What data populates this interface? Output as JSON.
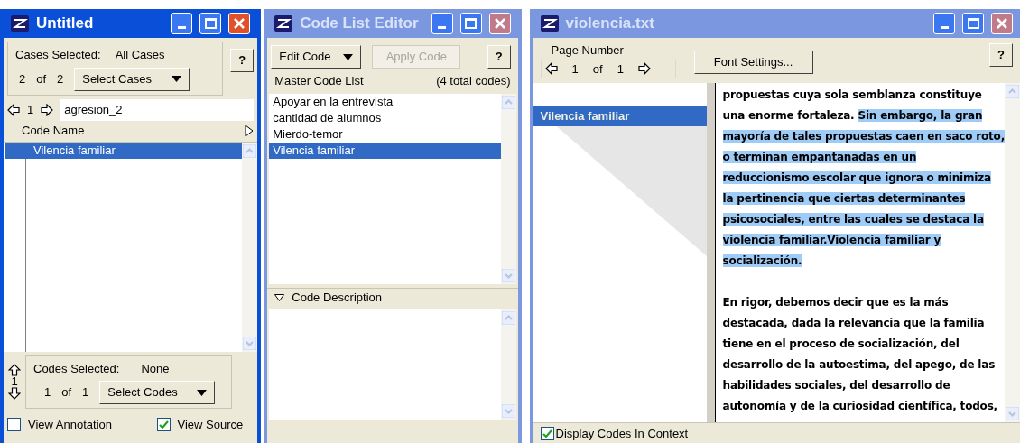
{
  "case_window": {
    "title": "Untitled",
    "active": true,
    "help_button": "?",
    "cases_selected_label": "Cases Selected:",
    "cases_selected_value": "All Cases",
    "case_index": "2",
    "case_of": "of",
    "case_total": "2",
    "select_cases_button": "Select Cases",
    "nav_index": "1",
    "case_name": "agresion_2",
    "column_header": "Code Name",
    "codes": [
      {
        "name": "Vilencia familiar",
        "selected": true
      }
    ],
    "codes_nav_index": "1",
    "codes_selected_label": "Codes Selected:",
    "codes_selected_value": "None",
    "code_index": "1",
    "code_of": "of",
    "code_total": "1",
    "select_codes_button": "Select Codes",
    "checkboxes": [
      {
        "label": "View Annotation",
        "checked": false
      },
      {
        "label": "View Source",
        "checked": true
      }
    ]
  },
  "code_list_editor": {
    "title": "Code List Editor",
    "active": false,
    "edit_code_button": "Edit Code",
    "apply_code_button": {
      "label": "Apply Code",
      "disabled": true
    },
    "help_button": "?",
    "list_label": "Master Code List",
    "total_codes": "(4 total codes)",
    "codes": [
      {
        "name": "Apoyar en la entrevista",
        "selected": false
      },
      {
        "name": "cantidad de alumnos",
        "selected": false
      },
      {
        "name": "Mierdo-temor",
        "selected": false
      },
      {
        "name": "Vilencia familiar",
        "selected": true
      }
    ],
    "description_header": "Code Description",
    "description_expanded": true
  },
  "document_window": {
    "title": "violencia.txt",
    "active": false,
    "page_number_label": "Page Number",
    "page_index": "1",
    "page_of": "of",
    "page_total": "1",
    "font_settings_button": "Font Settings...",
    "help_button": "?",
    "margin_codes": [
      {
        "name": "Vilencia familiar",
        "selected": true
      }
    ],
    "paragraphs": [
      [
        [
          {
            "text": "propuestas cuya sola semblanza constituye",
            "highlighted": false
          }
        ],
        [
          {
            "text": "una enorme fortaleza. ",
            "highlighted": false
          },
          {
            "text": "Sin embargo, la gran",
            "highlighted": true
          }
        ],
        [
          {
            "text": "mayoría de tales propuestas caen en saco roto,",
            "highlighted": true
          }
        ],
        [
          {
            "text": "o terminan empantanadas en un",
            "highlighted": true
          }
        ],
        [
          {
            "text": "reduccionismo escolar que ignora o minimiza",
            "highlighted": true
          }
        ],
        [
          {
            "text": "la pertinencia que ciertas determinantes",
            "highlighted": true
          }
        ],
        [
          {
            "text": "psicosociales, entre las cuales se destaca la",
            "highlighted": true
          }
        ],
        [
          {
            "text": "violencia familiar.Violencia familiar y",
            "highlighted": true
          }
        ],
        [
          {
            "text": "socialización.",
            "highlighted": true
          }
        ]
      ],
      [
        [
          {
            "text": "En rigor, debemos decir que es la más",
            "highlighted": false
          }
        ],
        [
          {
            "text": "destacada, dada la relevancia que la familia",
            "highlighted": false
          }
        ],
        [
          {
            "text": "tiene en el proceso de socialización, del",
            "highlighted": false
          }
        ],
        [
          {
            "text": "desarrollo de la autoestima, del apego, de las",
            "highlighted": false
          }
        ],
        [
          {
            "text": "habilidades sociales, del desarrollo de",
            "highlighted": false
          }
        ],
        [
          {
            "text": "autonomía y de la curiosidad científica, todos,",
            "highlighted": false
          }
        ]
      ]
    ],
    "display_codes": {
      "label": "Display Codes In Context",
      "checked": true
    }
  }
}
